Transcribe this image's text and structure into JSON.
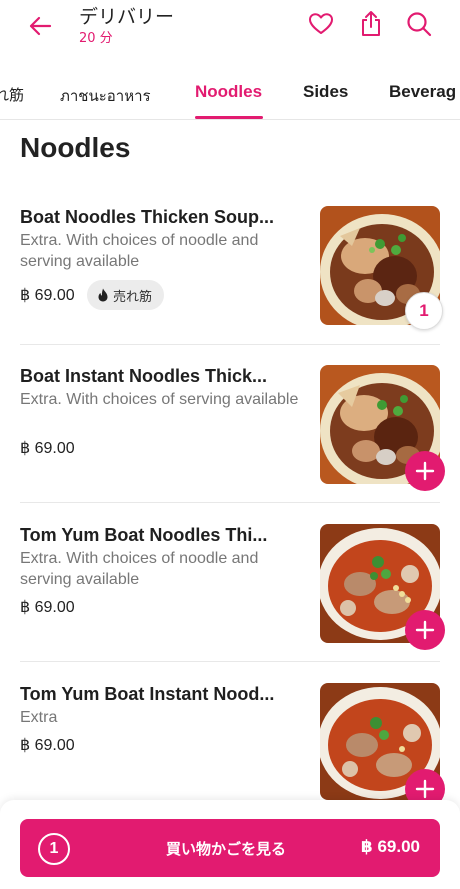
{
  "header": {
    "title": "デリバリー",
    "subtitle": "20 分",
    "icons": [
      "back-arrow-icon",
      "heart-icon",
      "share-icon",
      "search-icon"
    ]
  },
  "tabs": [
    {
      "label": "れ筋"
    },
    {
      "label": "ภาชนะอาหาร"
    },
    {
      "label": "Noodles",
      "active": true
    },
    {
      "label": "Sides"
    },
    {
      "label": "Beverag"
    }
  ],
  "section": {
    "title": "Noodles"
  },
  "items": [
    {
      "name": "Boat Noodles Thicken Soup...",
      "desc": "Extra. With choices of noodle and serving  available",
      "price": "฿ 69.00",
      "badge": "売れ筋",
      "quantity": "1"
    },
    {
      "name": "Boat Instant Noodles Thick...",
      "desc": "Extra. With choices of serving available",
      "price": "฿ 69.00",
      "add": "+"
    },
    {
      "name": "Tom Yum Boat Noodles Thi...",
      "desc": "Extra. With choices of noodle and serving  available",
      "price": "฿ 69.00",
      "add": "+"
    },
    {
      "name": "Tom Yum Boat Instant Nood...",
      "desc": "Extra",
      "price": "฿ 69.00",
      "add": "+"
    }
  ],
  "cart": {
    "count": "1",
    "label": "買い物かごを見る",
    "total": "฿ 69.00"
  },
  "colors": {
    "accent": "#e21b70",
    "badge_bg": "#ececec",
    "text": "#1f1f1f",
    "muted": "#777777"
  }
}
